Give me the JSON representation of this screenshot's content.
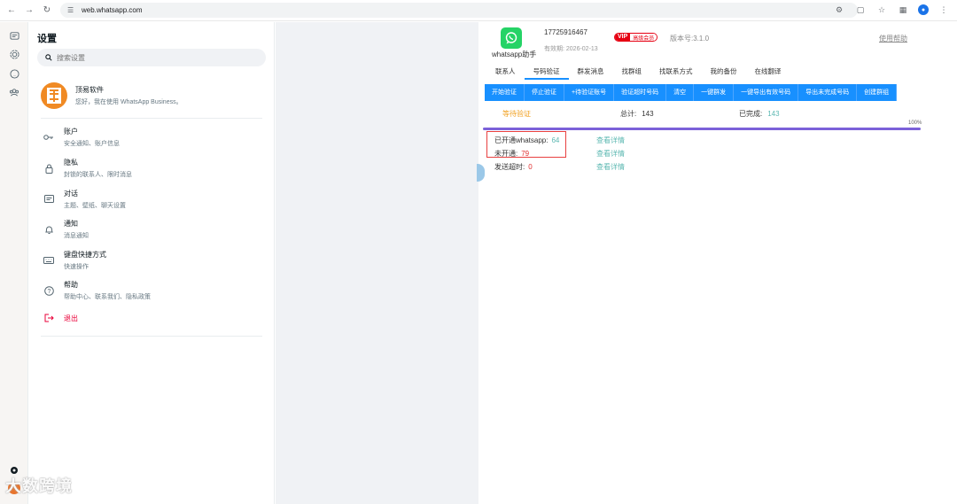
{
  "browser": {
    "url": "web.whatsapp.com"
  },
  "settings": {
    "title": "设置",
    "search_placeholder": "搜索设置",
    "profile": {
      "name": "顶易软件",
      "status": "您好，我在使用 WhatsApp Business。"
    },
    "menu": [
      {
        "title": "账户",
        "subtitle": "安全通知、账户信息",
        "icon": "key-icon"
      },
      {
        "title": "隐私",
        "subtitle": "封锁的联系人、限时消息",
        "icon": "lock-icon"
      },
      {
        "title": "对话",
        "subtitle": "主题、壁纸、聊天设置",
        "icon": "chat-icon"
      },
      {
        "title": "通知",
        "subtitle": "消息通知",
        "icon": "bell-icon"
      },
      {
        "title": "键盘快捷方式",
        "subtitle": "快速操作",
        "icon": "keyboard-icon"
      },
      {
        "title": "帮助",
        "subtitle": "帮助中心、联系我们、隐私政策",
        "icon": "help-icon"
      }
    ],
    "logout": "退出"
  },
  "helper": {
    "app_name": "whatsapp助手",
    "phone": "17725916467",
    "expire": "有效期: 2026-02-13",
    "vip_tag": "VIP",
    "vip_level": "高级会员",
    "version": "版本号:3.1.0",
    "help": "使用帮助",
    "tabs": [
      "联系人",
      "号码验证",
      "群发消息",
      "找群组",
      "找联系方式",
      "我的备份",
      "在线翻译"
    ],
    "active_tab": "号码验证",
    "actions": [
      "开始验证",
      "停止验证",
      "+待验证账号",
      "验证超时号码",
      "清空",
      "一键群发",
      "一键导出有效号码",
      "导出未完成号码",
      "创建群组"
    ],
    "stats": {
      "status": "等待验证",
      "total_label": "总计:",
      "total": "143",
      "done_label": "已完成:",
      "done": "143"
    },
    "progress": {
      "percent": 100,
      "label": "100%"
    },
    "results": {
      "opened_label": "已开通whatsapp:",
      "opened": "64",
      "not_opened_label": "未开通:",
      "not_opened": "79",
      "timeout_label": "发送超时:",
      "timeout": "0",
      "detail_link": "查看详情"
    }
  },
  "watermark": "大数跨境",
  "colors": {
    "accent": "#1890ff",
    "green": "#25d366",
    "teal": "#5cb8b2",
    "red": "#e60012",
    "progress": "#7b61d9"
  }
}
